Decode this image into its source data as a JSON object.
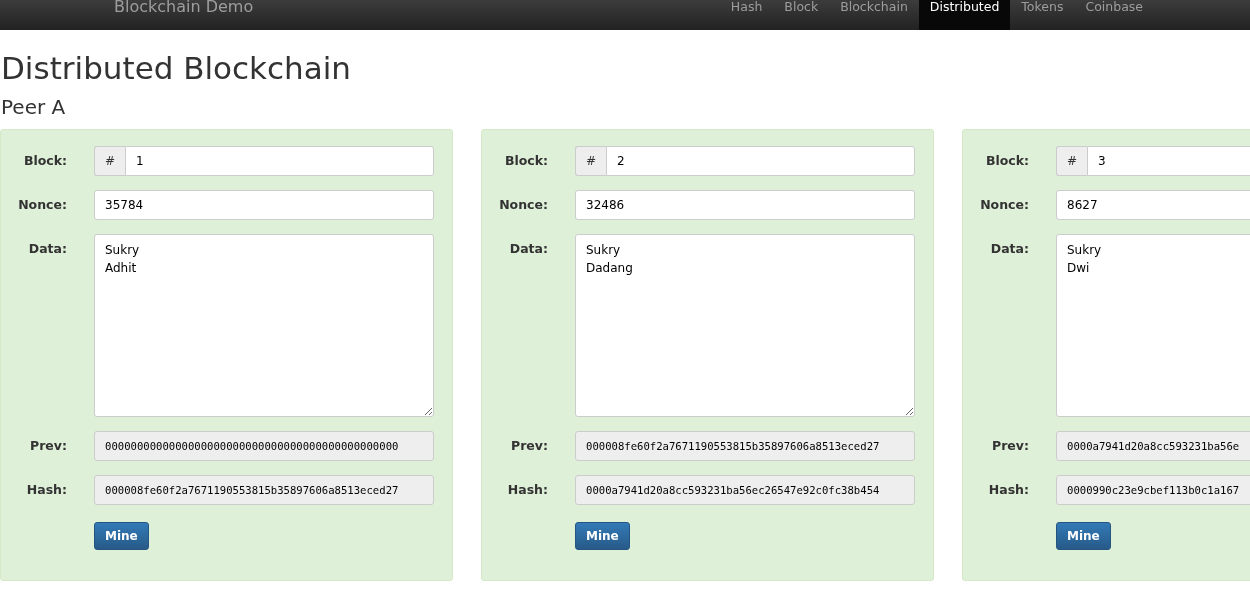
{
  "navbar": {
    "brand": "Blockchain Demo",
    "items": [
      {
        "label": "Hash",
        "selected": false
      },
      {
        "label": "Block",
        "selected": false
      },
      {
        "label": "Blockchain",
        "selected": false
      },
      {
        "label": "Distributed",
        "selected": true
      },
      {
        "label": "Tokens",
        "selected": false
      },
      {
        "label": "Coinbase",
        "selected": false
      }
    ]
  },
  "heading": "Distributed Blockchain",
  "peers": [
    {
      "name": "Peer A",
      "blocks": [
        {
          "valid": true,
          "block_label": "Block:",
          "prefix": "#",
          "number": "1",
          "nonce_label": "Nonce:",
          "nonce": "35784",
          "data_label": "Data:",
          "data": "Sukry\nAdhit",
          "prev_label": "Prev:",
          "prev": "0000000000000000000000000000000000000000000000",
          "hash_label": "Hash:",
          "hash": "000008fe60f2a7671190553815b35897606a8513eced27",
          "button": "Mine"
        },
        {
          "valid": true,
          "block_label": "Block:",
          "prefix": "#",
          "number": "2",
          "nonce_label": "Nonce:",
          "nonce": "32486",
          "data_label": "Data:",
          "data": "Sukry\nDadang",
          "prev_label": "Prev:",
          "prev": "000008fe60f2a7671190553815b35897606a8513eced27",
          "hash_label": "Hash:",
          "hash": "0000a7941d20a8cc593231ba56ec26547e92c0fc38b454",
          "button": "Mine"
        },
        {
          "valid": true,
          "block_label": "Block:",
          "prefix": "#",
          "number": "3",
          "nonce_label": "Nonce:",
          "nonce": "8627",
          "data_label": "Data:",
          "data": "Sukry\nDwi",
          "prev_label": "Prev:",
          "prev": "0000a7941d20a8cc593231ba56e",
          "hash_label": "Hash:",
          "hash": "0000990c23e9cbef113b0c1a167",
          "button": "Mine"
        }
      ]
    }
  ]
}
